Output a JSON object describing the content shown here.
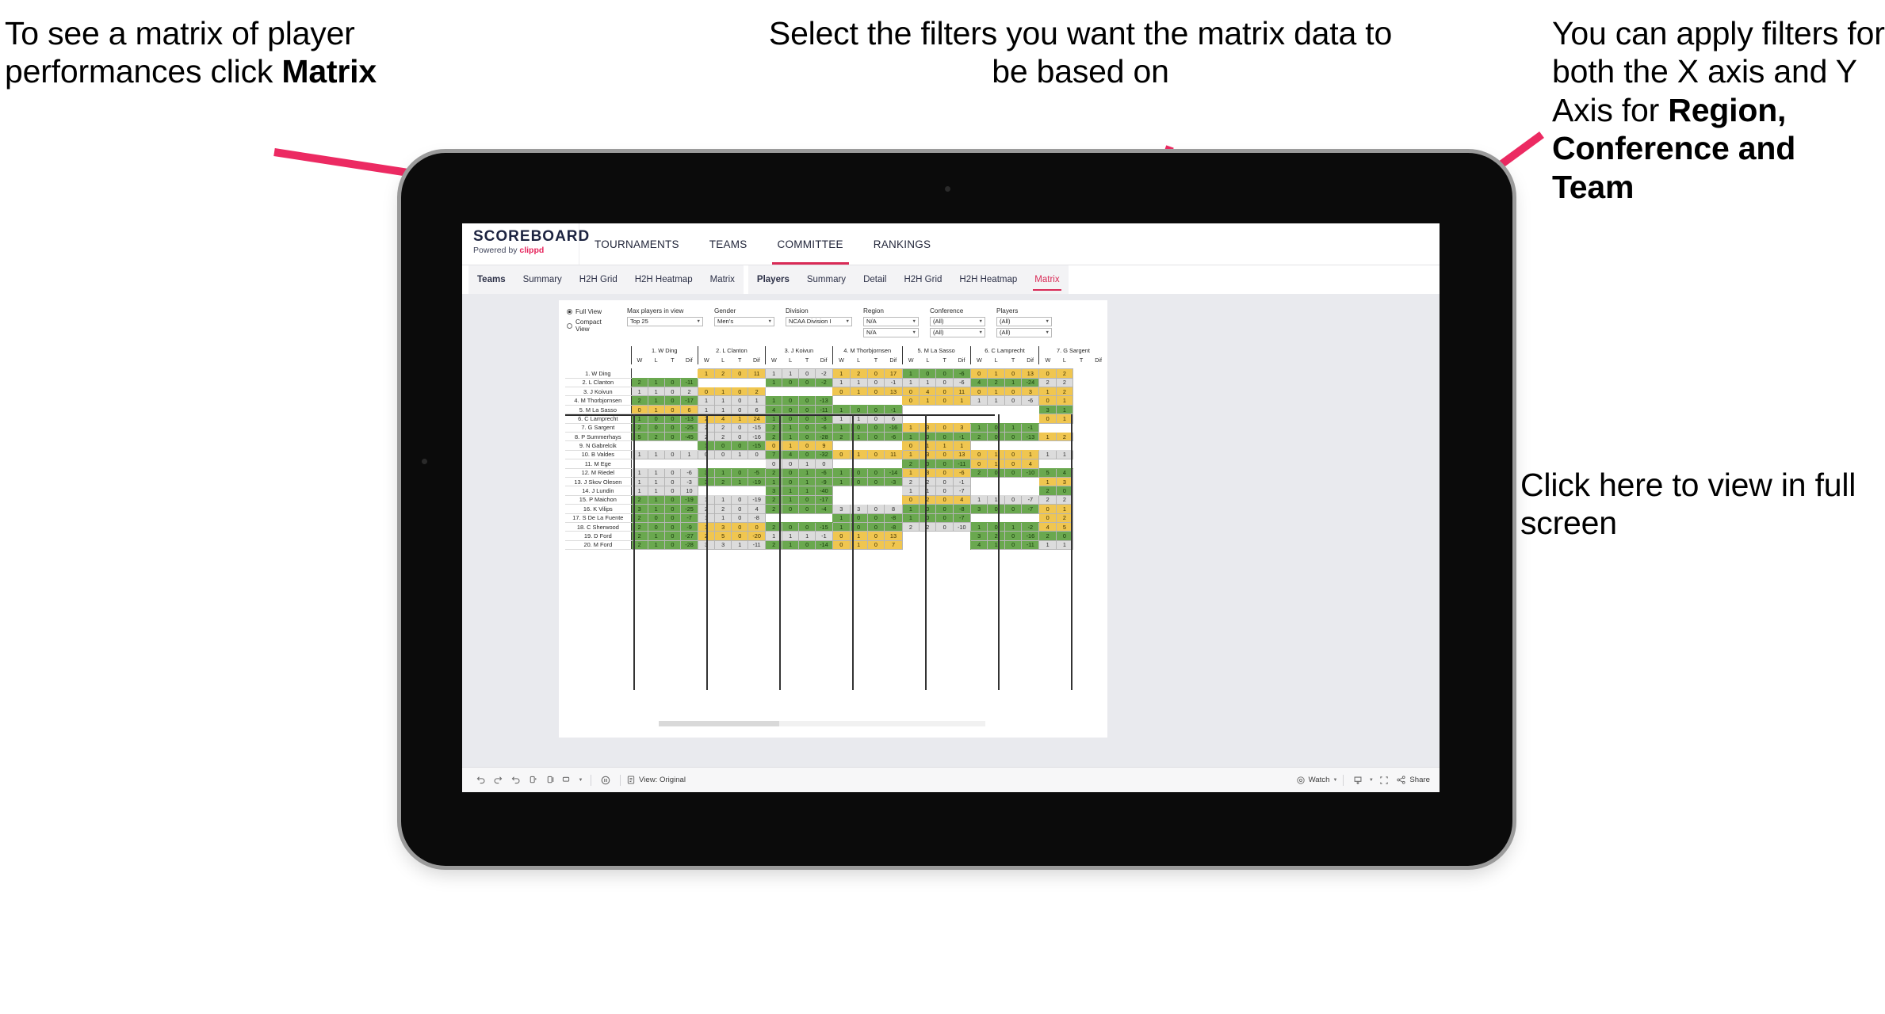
{
  "annotations": {
    "matrix_hint": {
      "pre": "To see a matrix of player performances click ",
      "bold": "Matrix"
    },
    "filters_hint": "Select the filters you want the matrix data to be based on",
    "axis_hint": {
      "pre": "You  can apply filters for both the X axis and Y Axis for ",
      "bold": "Region, Conference and Team"
    },
    "fullscreen_hint": "Click here to view in full screen"
  },
  "app": {
    "brand": {
      "title": "SCOREBOARD",
      "powered_prefix": "Powered by ",
      "powered_brand": "clippd"
    },
    "topnav": [
      {
        "label": "TOURNAMENTS",
        "active": false
      },
      {
        "label": "TEAMS",
        "active": false
      },
      {
        "label": "COMMITTEE",
        "active": true
      },
      {
        "label": "RANKINGS",
        "active": false
      }
    ],
    "subnav_teams": [
      {
        "label": "Teams",
        "lead": true,
        "active": false
      },
      {
        "label": "Summary",
        "lead": false,
        "active": false
      },
      {
        "label": "H2H Grid",
        "lead": false,
        "active": false
      },
      {
        "label": "H2H Heatmap",
        "lead": false,
        "active": false
      },
      {
        "label": "Matrix",
        "lead": false,
        "active": false
      }
    ],
    "subnav_players": [
      {
        "label": "Players",
        "lead": true,
        "active": false
      },
      {
        "label": "Summary",
        "lead": false,
        "active": false
      },
      {
        "label": "Detail",
        "lead": false,
        "active": false
      },
      {
        "label": "H2H Grid",
        "lead": false,
        "active": false
      },
      {
        "label": "H2H Heatmap",
        "lead": false,
        "active": false
      },
      {
        "label": "Matrix",
        "lead": false,
        "active": true
      }
    ]
  },
  "filters": {
    "view_options": [
      {
        "label": "Full View",
        "selected": true
      },
      {
        "label": "Compact View",
        "selected": false
      }
    ],
    "max_players": {
      "label": "Max players in view",
      "value": "Top 25"
    },
    "gender": {
      "label": "Gender",
      "value": "Men’s"
    },
    "division": {
      "label": "Division",
      "value": "NCAA Division I"
    },
    "region": {
      "label": "Region",
      "value_x": "N/A",
      "value_y": "N/A"
    },
    "conference": {
      "label": "Conference",
      "value_x": "(All)",
      "value_y": "(All)"
    },
    "players": {
      "label": "Players",
      "value_x": "(All)",
      "value_y": "(All)"
    }
  },
  "toolbar": {
    "icons": [
      "undo-icon",
      "redo-icon",
      "revert-icon",
      "refresh-icon",
      "pause-icon",
      "presentation-icon"
    ],
    "view_label": "View: Original",
    "watch_label": "Watch",
    "share_label": "Share"
  },
  "matrix": {
    "sub_headers": [
      "W",
      "L",
      "T",
      "Dif"
    ],
    "column_players": [
      "1. W Ding",
      "2. L Clanton",
      "3. J Koivun",
      "4. M Thorbjornsen",
      "5. M La Sasso",
      "6. C Lamprecht",
      "7. G Sargent"
    ],
    "row_players": [
      "1. W Ding",
      "2. L Clanton",
      "3. J Koivun",
      "4. M Thorbjornsen",
      "5. M La Sasso",
      "6. C Lamprecht",
      "7. G Sargent",
      "8. P Summerhays",
      "9. N Gabrelcik",
      "10. B Valdes",
      "11. M Ege",
      "12. M Riedel",
      "13. J Skov Olesen",
      "14. J Lundin",
      "15. P Maichon",
      "16. K Vilips",
      "17. S De La Fuente",
      "18. C Sherwood",
      "19. D Ford",
      "20. M Ford"
    ],
    "rows": [
      [
        null,
        [
          "gold",
          [
            1,
            2,
            0,
            11
          ]
        ],
        [
          "gray",
          [
            1,
            1,
            0,
            -2
          ]
        ],
        [
          "gold",
          [
            1,
            2,
            0,
            17
          ]
        ],
        [
          "green",
          [
            1,
            0,
            0,
            -6
          ]
        ],
        [
          "gold",
          [
            0,
            1,
            0,
            13
          ]
        ],
        [
          "gold",
          [
            0,
            2,
            null,
            null
          ]
        ]
      ],
      [
        [
          "green",
          [
            2,
            1,
            0,
            -11
          ]
        ],
        null,
        [
          "green",
          [
            1,
            0,
            0,
            -2
          ]
        ],
        [
          "gray",
          [
            1,
            1,
            0,
            -1
          ]
        ],
        [
          "gray",
          [
            1,
            1,
            0,
            -6
          ]
        ],
        [
          "green",
          [
            4,
            2,
            1,
            -24
          ]
        ],
        [
          "gray",
          [
            2,
            2,
            null,
            null
          ]
        ]
      ],
      [
        [
          "gray",
          [
            1,
            1,
            0,
            2
          ]
        ],
        [
          "gold",
          [
            0,
            1,
            0,
            2
          ]
        ],
        null,
        [
          "gold",
          [
            0,
            1,
            0,
            13
          ]
        ],
        [
          "gold",
          [
            0,
            4,
            0,
            11
          ]
        ],
        [
          "gold",
          [
            0,
            1,
            0,
            3
          ]
        ],
        [
          "gold",
          [
            1,
            2,
            null,
            null
          ]
        ]
      ],
      [
        [
          "green",
          [
            2,
            1,
            0,
            -17
          ]
        ],
        [
          "gray",
          [
            1,
            1,
            0,
            1
          ]
        ],
        [
          "green",
          [
            1,
            0,
            0,
            -13
          ]
        ],
        null,
        [
          "gold",
          [
            0,
            1,
            0,
            1
          ]
        ],
        [
          "gray",
          [
            1,
            1,
            0,
            -6
          ]
        ],
        [
          "gold",
          [
            0,
            1,
            null,
            null
          ]
        ]
      ],
      [
        [
          "gold",
          [
            0,
            1,
            0,
            6
          ]
        ],
        [
          "gray",
          [
            1,
            1,
            0,
            6
          ]
        ],
        [
          "green",
          [
            4,
            0,
            0,
            -11
          ]
        ],
        [
          "green",
          [
            1,
            0,
            0,
            -1
          ]
        ],
        null,
        null,
        [
          "green",
          [
            3,
            1,
            null,
            null
          ]
        ]
      ],
      [
        [
          "green",
          [
            1,
            0,
            0,
            -13
          ]
        ],
        [
          "gold",
          [
            2,
            4,
            1,
            24
          ]
        ],
        [
          "green",
          [
            1,
            0,
            0,
            -3
          ]
        ],
        [
          "gray",
          [
            1,
            1,
            0,
            6
          ]
        ],
        null,
        null,
        [
          "gold",
          [
            0,
            1,
            null,
            null
          ]
        ]
      ],
      [
        [
          "green",
          [
            2,
            0,
            0,
            -25
          ]
        ],
        [
          "gray",
          [
            2,
            2,
            0,
            -15
          ]
        ],
        [
          "green",
          [
            2,
            1,
            0,
            -6
          ]
        ],
        [
          "green",
          [
            1,
            0,
            0,
            -16
          ]
        ],
        [
          "gold",
          [
            1,
            3,
            0,
            3
          ]
        ],
        [
          "green",
          [
            1,
            0,
            1,
            -1
          ]
        ],
        null
      ],
      [
        [
          "green",
          [
            5,
            2,
            0,
            -45
          ]
        ],
        [
          "gray",
          [
            2,
            2,
            0,
            -16
          ]
        ],
        [
          "green",
          [
            2,
            1,
            0,
            -28
          ]
        ],
        [
          "green",
          [
            2,
            1,
            0,
            -6
          ]
        ],
        [
          "green",
          [
            1,
            0,
            0,
            -1
          ]
        ],
        [
          "green",
          [
            2,
            0,
            0,
            -13
          ]
        ],
        [
          "gold",
          [
            1,
            2,
            null,
            null
          ]
        ]
      ],
      [
        null,
        [
          "green",
          [
            1,
            0,
            0,
            -15
          ]
        ],
        [
          "gold",
          [
            0,
            1,
            0,
            9
          ]
        ],
        null,
        [
          "gold",
          [
            0,
            1,
            1,
            1
          ]
        ],
        null,
        null
      ],
      [
        [
          "gray",
          [
            1,
            1,
            0,
            1
          ]
        ],
        [
          "gray",
          [
            0,
            0,
            1,
            0
          ]
        ],
        [
          "green",
          [
            7,
            4,
            0,
            -32
          ]
        ],
        [
          "gold",
          [
            0,
            1,
            0,
            11
          ]
        ],
        [
          "gold",
          [
            1,
            3,
            0,
            13
          ]
        ],
        [
          "gold",
          [
            0,
            1,
            0,
            1
          ]
        ],
        [
          "gray",
          [
            1,
            1,
            null,
            null
          ]
        ]
      ],
      [
        null,
        null,
        [
          "gray",
          [
            0,
            0,
            1,
            0
          ]
        ],
        null,
        [
          "green",
          [
            2,
            0,
            0,
            -11
          ]
        ],
        [
          "gold",
          [
            0,
            1,
            0,
            4
          ]
        ],
        null
      ],
      [
        [
          "gray",
          [
            1,
            1,
            0,
            -6
          ]
        ],
        [
          "green",
          [
            3,
            1,
            0,
            -5
          ]
        ],
        [
          "green",
          [
            2,
            0,
            1,
            -6
          ]
        ],
        [
          "green",
          [
            1,
            0,
            0,
            -14
          ]
        ],
        [
          "gold",
          [
            1,
            3,
            0,
            -6
          ]
        ],
        [
          "green",
          [
            2,
            0,
            0,
            -10
          ]
        ],
        [
          "green",
          [
            5,
            4,
            null,
            null
          ]
        ]
      ],
      [
        [
          "gray",
          [
            1,
            1,
            0,
            -3
          ]
        ],
        [
          "green",
          [
            3,
            2,
            1,
            -19
          ]
        ],
        [
          "green",
          [
            1,
            0,
            1,
            -9
          ]
        ],
        [
          "green",
          [
            1,
            0,
            0,
            -3
          ]
        ],
        [
          "gray",
          [
            2,
            2,
            0,
            -1
          ]
        ],
        null,
        [
          "gold",
          [
            1,
            3,
            null,
            null
          ]
        ]
      ],
      [
        [
          "gray",
          [
            1,
            1,
            0,
            10
          ]
        ],
        null,
        [
          "green",
          [
            3,
            1,
            1,
            -40
          ]
        ],
        null,
        [
          "gray",
          [
            1,
            1,
            0,
            -7
          ]
        ],
        null,
        [
          "green",
          [
            2,
            0,
            null,
            null
          ]
        ]
      ],
      [
        [
          "green",
          [
            2,
            1,
            0,
            -19
          ]
        ],
        [
          "gray",
          [
            1,
            1,
            0,
            -19
          ]
        ],
        [
          "green",
          [
            2,
            1,
            0,
            -17
          ]
        ],
        null,
        [
          "gold",
          [
            0,
            2,
            0,
            4
          ]
        ],
        [
          "gray",
          [
            1,
            1,
            0,
            -7
          ]
        ],
        [
          "gray",
          [
            2,
            2,
            null,
            null
          ]
        ]
      ],
      [
        [
          "green",
          [
            3,
            1,
            0,
            -25
          ]
        ],
        [
          "gray",
          [
            2,
            2,
            0,
            4
          ]
        ],
        [
          "green",
          [
            2,
            0,
            0,
            -4
          ]
        ],
        [
          "gray",
          [
            3,
            3,
            0,
            8
          ]
        ],
        [
          "green",
          [
            1,
            0,
            0,
            -8
          ]
        ],
        [
          "green",
          [
            3,
            0,
            0,
            -7
          ]
        ],
        [
          "gold",
          [
            0,
            1,
            null,
            null
          ]
        ]
      ],
      [
        [
          "green",
          [
            2,
            0,
            0,
            -7
          ]
        ],
        [
          "gray",
          [
            1,
            1,
            0,
            -8
          ]
        ],
        null,
        [
          "green",
          [
            1,
            0,
            0,
            -8
          ]
        ],
        [
          "green",
          [
            1,
            0,
            0,
            -7
          ]
        ],
        null,
        [
          "gold",
          [
            0,
            2,
            null,
            null
          ]
        ]
      ],
      [
        [
          "green",
          [
            2,
            0,
            0,
            -9
          ]
        ],
        [
          "gold",
          [
            1,
            3,
            0,
            0
          ]
        ],
        [
          "green",
          [
            2,
            0,
            0,
            -15
          ]
        ],
        [
          "green",
          [
            1,
            0,
            0,
            -8
          ]
        ],
        [
          "gray",
          [
            2,
            2,
            0,
            -10
          ]
        ],
        [
          "green",
          [
            1,
            0,
            1,
            -2
          ]
        ],
        [
          "gold",
          [
            4,
            5,
            null,
            null
          ]
        ]
      ],
      [
        [
          "green",
          [
            2,
            1,
            0,
            -27
          ]
        ],
        [
          "gold",
          [
            2,
            5,
            0,
            -20
          ]
        ],
        [
          "gray",
          [
            1,
            1,
            1,
            -1
          ]
        ],
        [
          "gold",
          [
            0,
            1,
            0,
            13
          ]
        ],
        null,
        [
          "green",
          [
            3,
            2,
            0,
            -16
          ]
        ],
        [
          "green",
          [
            2,
            0,
            null,
            null
          ]
        ]
      ],
      [
        [
          "green",
          [
            2,
            1,
            0,
            -28
          ]
        ],
        [
          "gray",
          [
            3,
            3,
            1,
            -11
          ]
        ],
        [
          "green",
          [
            2,
            1,
            0,
            -14
          ]
        ],
        [
          "gold",
          [
            0,
            1,
            0,
            7
          ]
        ],
        null,
        [
          "green",
          [
            4,
            1,
            0,
            -11
          ]
        ],
        [
          "gray",
          [
            1,
            1,
            null,
            null
          ]
        ]
      ]
    ]
  }
}
